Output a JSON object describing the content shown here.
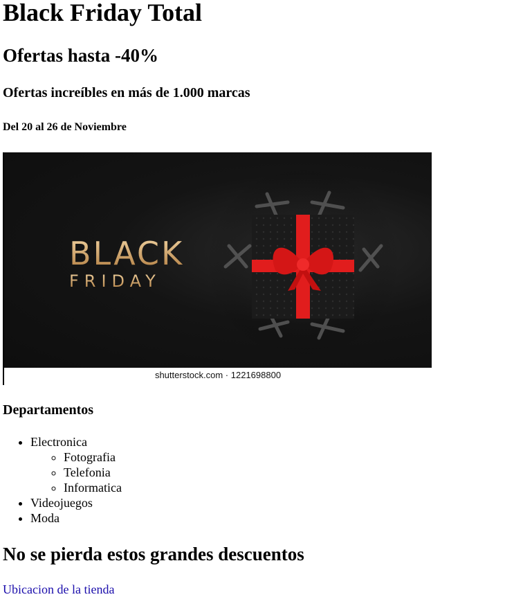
{
  "headings": {
    "h1": "Black Friday Total",
    "h2": "Ofertas hasta -40%",
    "h3": "Ofertas increíbles en más de 1.000 marcas",
    "h5": "Del 20 al 26 de Noviembre"
  },
  "banner": {
    "word_top": "BLACK",
    "word_bottom": "FRIDAY",
    "caption": "shutterstock.com · 1221698800"
  },
  "departments": {
    "title": "Departamentos",
    "items": [
      {
        "label": "Electronica",
        "children": [
          "Fotografia",
          "Telefonia",
          "Informatica"
        ]
      },
      {
        "label": "Videojuegos"
      },
      {
        "label": "Moda"
      }
    ]
  },
  "promo_heading": "No se pierda estos grandes descuentos",
  "store_link": "Ubicacion de la tienda",
  "colors": {
    "link": "#1a0dab",
    "ribbon": "#e11d1d",
    "gold": "#d9b178"
  }
}
